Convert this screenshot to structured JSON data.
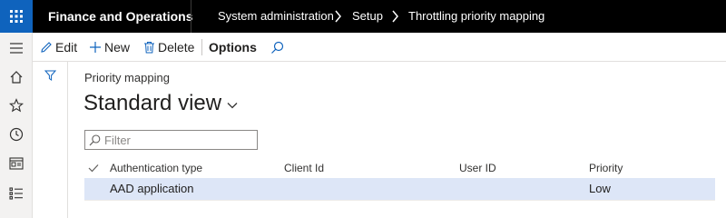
{
  "topbar": {
    "app_name": "Finance and Operations",
    "breadcrumb": [
      "System administration",
      "Setup",
      "Throttling priority mapping"
    ]
  },
  "actions": {
    "edit": "Edit",
    "new": "New",
    "delete": "Delete",
    "options": "Options"
  },
  "nav_icons": [
    "hamburger-icon",
    "home-icon",
    "star-icon",
    "clock-icon",
    "workspace-icon",
    "list-icon"
  ],
  "page": {
    "caption": "Priority mapping",
    "view_name": "Standard view"
  },
  "filter": {
    "placeholder": "Filter"
  },
  "grid": {
    "columns": [
      "Authentication type",
      "Client Id",
      "User ID",
      "Priority"
    ],
    "rows": [
      {
        "auth_type": "AAD application",
        "client_id": "",
        "user_id": "",
        "priority": "Low"
      }
    ]
  },
  "colors": {
    "accent": "#0f63bd",
    "selected_row": "#dde6f7",
    "topbar": "#000000"
  }
}
